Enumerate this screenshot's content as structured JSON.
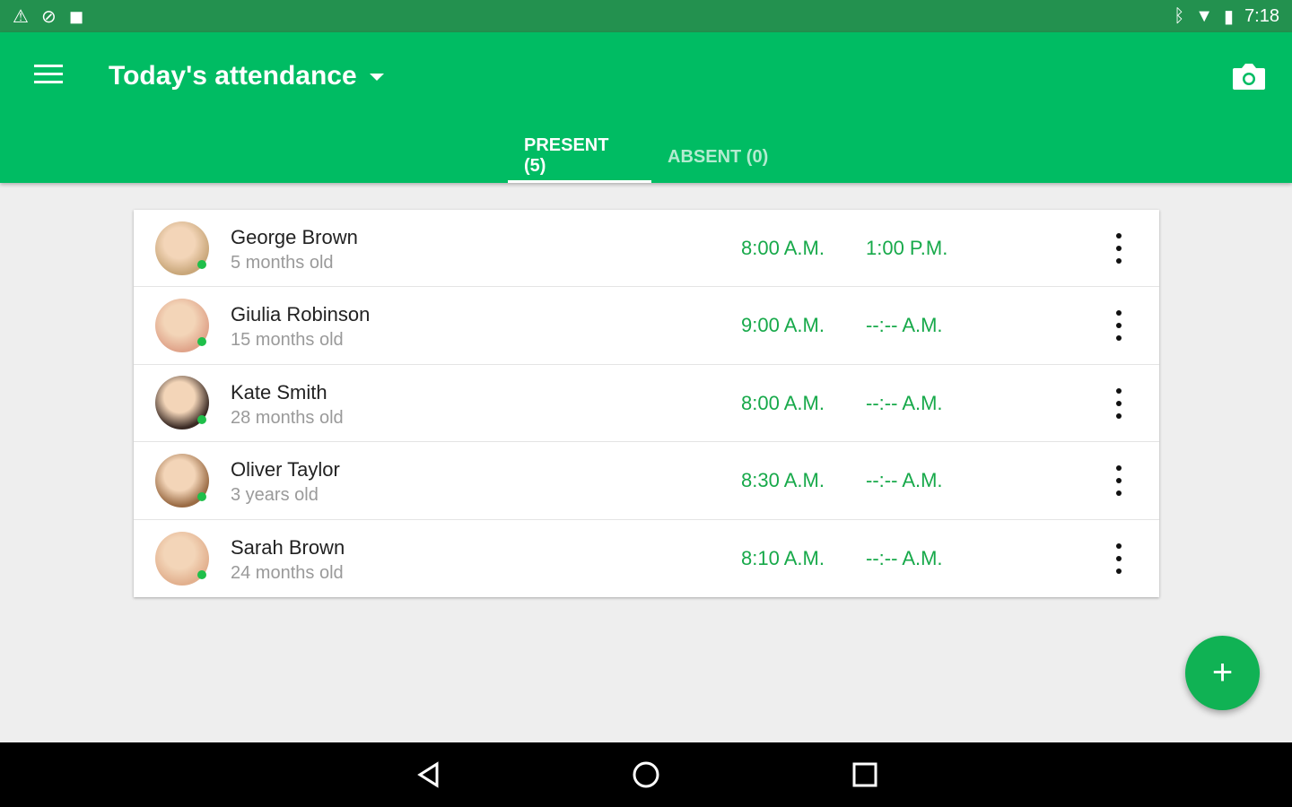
{
  "status_bar": {
    "time": "7:18",
    "left_icons": [
      "warning-icon",
      "sync-disabled-icon",
      "android-icon"
    ],
    "right_icons": [
      "bluetooth-icon",
      "wifi-icon",
      "battery-icon"
    ]
  },
  "app_bar": {
    "title": "Today's attendance"
  },
  "tabs": [
    {
      "label": "PRESENT (5)",
      "active": true
    },
    {
      "label": "ABSENT (0)",
      "active": false
    }
  ],
  "children": [
    {
      "name": "George Brown",
      "age": "5 months old",
      "check_in": "8:00 A.M.",
      "check_out": "1:00 P.M.",
      "avatar_color": "#c9a77a"
    },
    {
      "name": "Giulia Robinson",
      "age": "15 months old",
      "check_in": "9:00 A.M.",
      "check_out": "--:-- A.M.",
      "avatar_color": "#e0a48a"
    },
    {
      "name": "Kate Smith",
      "age": "28 months old",
      "check_in": "8:00 A.M.",
      "check_out": "--:-- A.M.",
      "avatar_color": "#3a2a24"
    },
    {
      "name": "Oliver Taylor",
      "age": "3 years old",
      "check_in": "8:30 A.M.",
      "check_out": "--:-- A.M.",
      "avatar_color": "#9a6b44"
    },
    {
      "name": "Sarah Brown",
      "age": "24 months old",
      "check_in": "8:10 A.M.",
      "check_out": "--:-- A.M.",
      "avatar_color": "#e2b08e"
    }
  ],
  "fab": {
    "label": "+"
  }
}
